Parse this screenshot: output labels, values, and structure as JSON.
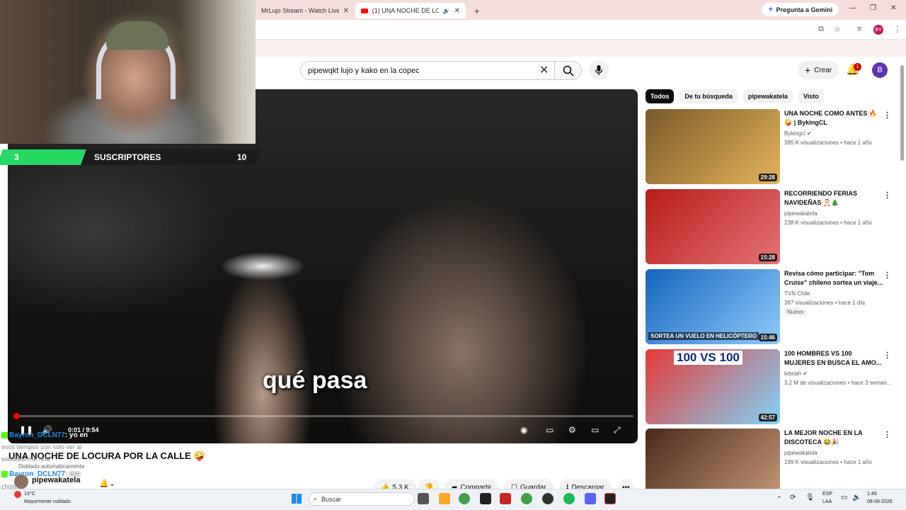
{
  "browser": {
    "tabs": [
      {
        "label": "MrLujo Stream - Watch Live on",
        "close": "✕"
      },
      {
        "label": "(1) UNA NOCHE DE LOCURA",
        "close": "✕"
      }
    ],
    "new_tab": "+",
    "gemini_label": "Pregunta a Gemini",
    "profile_letter": "BY"
  },
  "youtube": {
    "search_value": "pipewqkt lujo y kako en la copec",
    "create_label": "Crear",
    "notif_count": "1",
    "avatar_letter": "B",
    "chips": [
      "Todos",
      "De tu búsqueda",
      "pipewakatela",
      "Visto"
    ]
  },
  "video": {
    "subtitle": "qué pasa",
    "time": "0:01 / 9:54",
    "progress": 0.002,
    "title": "UNA NOCHE DE LOCURA POR LA CALLE 🤪",
    "dubbed": "Doblado automáticamente",
    "channel": "pipewakatela",
    "likes": "5,3 K",
    "share": "Compartir",
    "save": "Guardar",
    "download": "Descargar",
    "more": "•••"
  },
  "overlay": {
    "subs_left": "3",
    "subs_title": "SUSCRIPTORES",
    "subs_right": "10",
    "chat": [
      {
        "user": "Bayron_DCLN77",
        "msg": ": yo en"
      },
      {
        "gray": "esos tiempos con solo ver al"
      },
      {
        "gray": "wasatela me reía"
      },
      {
        "user": "Bayron_DCLN77",
        "msg": ": era"
      },
      {
        "gray": "chistoso"
      },
      {
        "gray": "Mayormente nublado"
      }
    ]
  },
  "recommendations": [
    {
      "title": "UNA NOCHE COMO ANTES 🔥🤪 | BykingCL",
      "channel": "Bykingcl ✔",
      "meta": "395 K visualizaciones • hace 1 año",
      "duration": "29:28",
      "colors": [
        "#7a5a2a",
        "#e3b45a"
      ]
    },
    {
      "title": "RECORRIENDO FERIAS NAVIDEÑAS 🎅🎄",
      "channel": "pipewakatela",
      "meta": "238 K visualizaciones • hace 1 año",
      "duration": "15:28",
      "colors": [
        "#b71c1c",
        "#e57373"
      ]
    },
    {
      "title": "Revisa cómo participar: \"Tom Cruise\" chileno sortea un viaje...",
      "channel": "TVN Chile",
      "meta": "387 visualizaciones • hace 1 día",
      "badge": "Nuevo",
      "duration": "15:46",
      "overlay_text": "SORTEA UN VUELO EN HELICÓPTERO",
      "colors": [
        "#1565c0",
        "#90caf9"
      ]
    },
    {
      "title": "100 HOMBRES VS 100 MUJERES EN BUSCA EL AMO...",
      "channel": "lebriah ✔",
      "meta": "3,2 M de visualizaciones • hace 3 seman...",
      "duration": "42:57",
      "overlay_text": "100 VS 100",
      "colors": [
        "#e53935",
        "#81d4fa"
      ]
    },
    {
      "title": "LA MEJOR NOCHE EN LA DISCOTECA 😂🎉",
      "channel": "pipewakatela",
      "meta": "199 K visualizaciones • hace 1 año",
      "duration": "",
      "colors": [
        "#4a2a1a",
        "#c89a7a"
      ]
    }
  ],
  "taskbar": {
    "weather_temp": "13°C",
    "search_label": "Buscar",
    "lang1": "ESP",
    "lang2": "LAA",
    "time": "1:49",
    "date": "08-08-2026"
  }
}
